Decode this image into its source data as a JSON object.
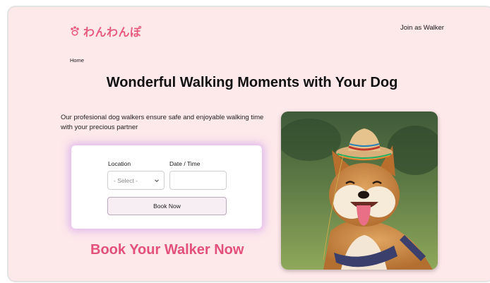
{
  "header": {
    "logo_text": "わんわんぽ",
    "join_link": "Join as Walker"
  },
  "breadcrumb": "Home",
  "hero": {
    "title": "Wonderful Walking Moments with Your Dog",
    "description": "Our profesional dog walkers ensure safe and enjoyable walking time with your precious partner"
  },
  "booking": {
    "location_label": "Location",
    "location_value": "- Select -",
    "datetime_label": "Date / Time",
    "datetime_value": "",
    "book_button": "Book Now"
  },
  "cta": "Book Your Walker Now",
  "colors": {
    "background": "#fde8ea",
    "brand_pink": "#e85a7e",
    "cta_pink": "#e3507a",
    "card_glow": "#cd96f0"
  },
  "icons": {
    "logo": "paw-icon",
    "select": "chevron-down-icon"
  }
}
